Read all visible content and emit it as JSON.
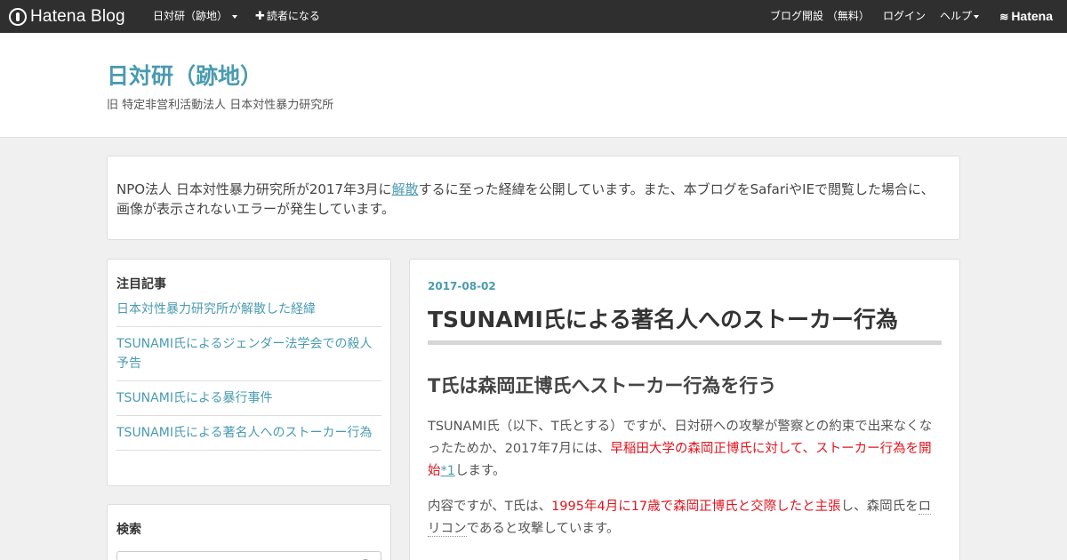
{
  "topbar": {
    "brand": "Hatena Blog",
    "blog_menu": "日対研（跡地）",
    "subscribe": "読者になる",
    "create_blog": "ブログ開設 （無料）",
    "login": "ログイン",
    "help": "ヘルプ",
    "hatena": "Hatena"
  },
  "header": {
    "title": "日対研（跡地）",
    "description": "旧 特定非営利活動法人 日本対性暴力研究所"
  },
  "notice": {
    "text_before": "NPO法人 日本対性暴力研究所が2017年3月に",
    "link": "解散",
    "text_after": "するに至った経緯を公開しています。また、本ブログをSafariやIEで閲覧した場合に、画像が表示されないエラーが発生しています。"
  },
  "sidebar": {
    "featured_title": "注目記事",
    "featured_items": [
      "日本対性暴力研究所が解散した経緯",
      "TSUNAMI氏によるジェンダー法学会での殺人予告",
      "TSUNAMI氏による暴行事件",
      "TSUNAMI氏による著名人へのストーカー行為"
    ],
    "search_title": "検索"
  },
  "entry": {
    "date": "2017-08-02",
    "title": "TSUNAMI氏による著名人へのストーカー行為",
    "h2": "T氏は森岡正博氏へストーカー行為を行う",
    "p1_a": "TSUNAMI氏（以下、T氏とする）ですが、日対研への攻撃が警察との約束で出来なくなったためか、2017年7月には、",
    "p1_red": "早稲田大学の森岡正博氏に対して、ストーカー行為を開始",
    "p1_fn": "*1",
    "p1_b": "します。",
    "p2_a": "内容ですが、T氏は、",
    "p2_red": "1995年4月に17歳で森岡正博氏と交際したと主張",
    "p2_b": "し、森岡氏を",
    "p2_c": "ロリコン",
    "p2_d": "であると攻撃しています。"
  }
}
